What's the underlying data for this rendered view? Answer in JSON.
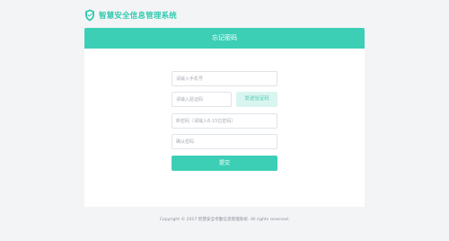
{
  "brand": {
    "name": "智慧安全信息管理系统",
    "accent_color": "#35cbb0",
    "logo_icon": "shield-icon"
  },
  "card": {
    "title": "忘记密码"
  },
  "form": {
    "phone_placeholder": "请输入手机号",
    "code_placeholder": "请输入验证码",
    "send_code_label": "发送验证码",
    "new_password_placeholder": "新密码（请输入6-15位密码）",
    "confirm_password_placeholder": "确认密码",
    "submit_label": "提交"
  },
  "footer": {
    "copyright": "Copyright © 2017 智慧安全考勤信息管理系统. All rights reserved."
  },
  "colors": {
    "primary": "#3dcfb6",
    "secondary_button_bg": "#d9f5ef",
    "page_bg": "#f3f4f6"
  }
}
